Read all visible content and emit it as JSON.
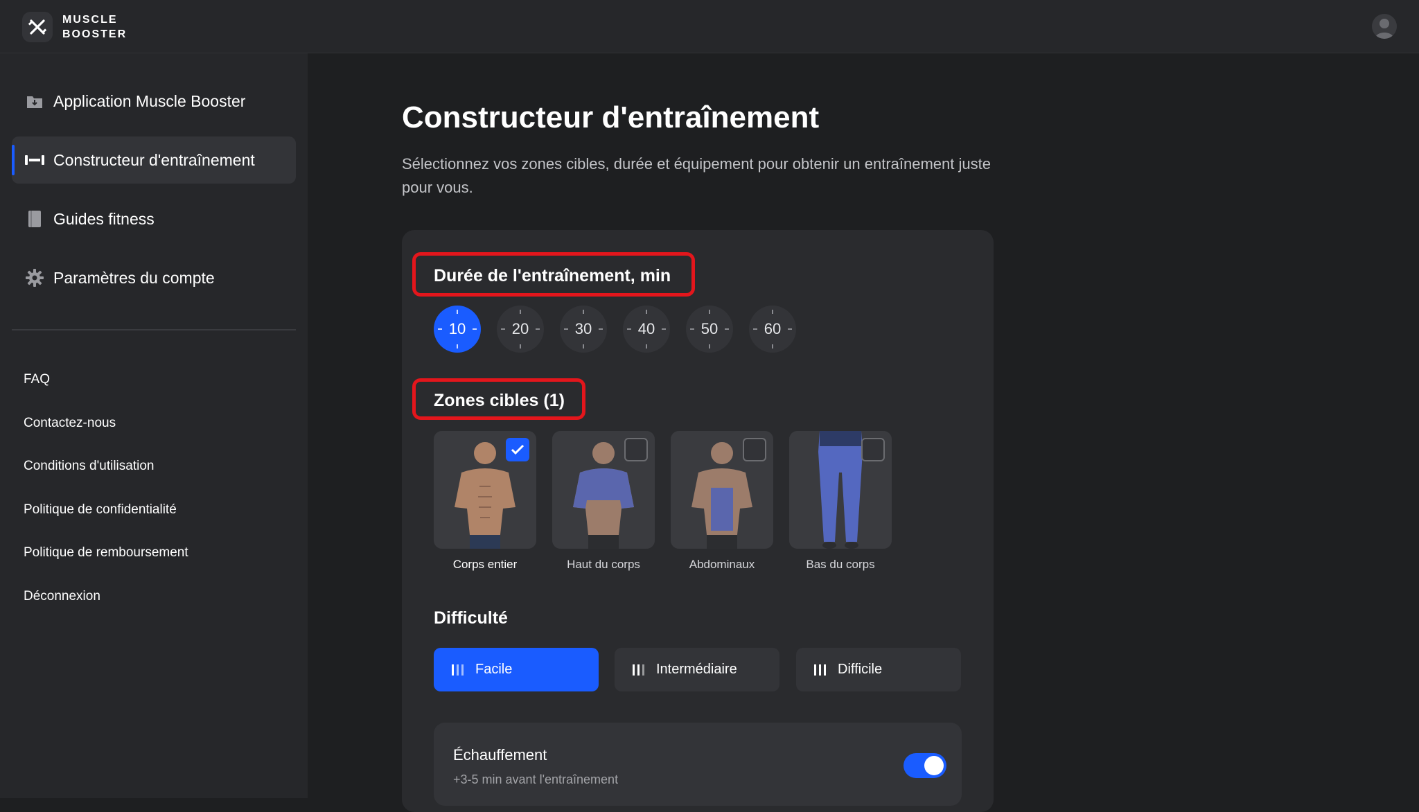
{
  "app": {
    "logo_line1": "MUSCLE",
    "logo_line2": "BOOSTER",
    "logo_icon": "crossed-dumbbell-logo",
    "avatar_icon": "user-avatar-icon"
  },
  "sidebar": {
    "nav_items": [
      {
        "label": "Application Muscle Booster",
        "icon": "app-download-icon",
        "active": false
      },
      {
        "label": "Constructeur d'entraînement",
        "icon": "dumbbell-icon",
        "active": true
      },
      {
        "label": "Guides fitness",
        "icon": "book-icon",
        "active": false
      },
      {
        "label": "Paramètres du compte",
        "icon": "gear-icon",
        "active": false
      }
    ],
    "links": [
      {
        "label": "FAQ"
      },
      {
        "label": "Contactez-nous"
      },
      {
        "label": "Conditions d'utilisation"
      },
      {
        "label": "Politique de confidentialité"
      },
      {
        "label": "Politique de remboursement"
      },
      {
        "label": "Déconnexion"
      }
    ]
  },
  "main": {
    "title": "Constructeur d'entraînement",
    "subtitle": "Sélectionnez vos zones cibles, durée et équipement pour obtenir un entraînement juste pour vous.",
    "duration": {
      "title": "Durée de l'entraînement, min",
      "options": [
        "10",
        "20",
        "30",
        "40",
        "50",
        "60"
      ],
      "selected": "10"
    },
    "zones": {
      "title": "Zones cibles (1)",
      "items": [
        {
          "label": "Corps entier",
          "checked": true
        },
        {
          "label": "Haut du corps",
          "checked": false
        },
        {
          "label": "Abdominaux",
          "checked": false
        },
        {
          "label": "Bas du corps",
          "checked": false
        }
      ]
    },
    "difficulty": {
      "title": "Difficulté",
      "options": [
        "Facile",
        "Intermédiaire",
        "Difficile"
      ],
      "selected": "Facile"
    },
    "warmup": {
      "title": "Échauffement",
      "subtitle": "+3-5 min avant l'entraînement",
      "enabled": true
    }
  },
  "colors": {
    "accent": "#1a5cff",
    "highlight": "#e3161c",
    "background": "#1e1f21",
    "sidebar": "#26272a"
  }
}
